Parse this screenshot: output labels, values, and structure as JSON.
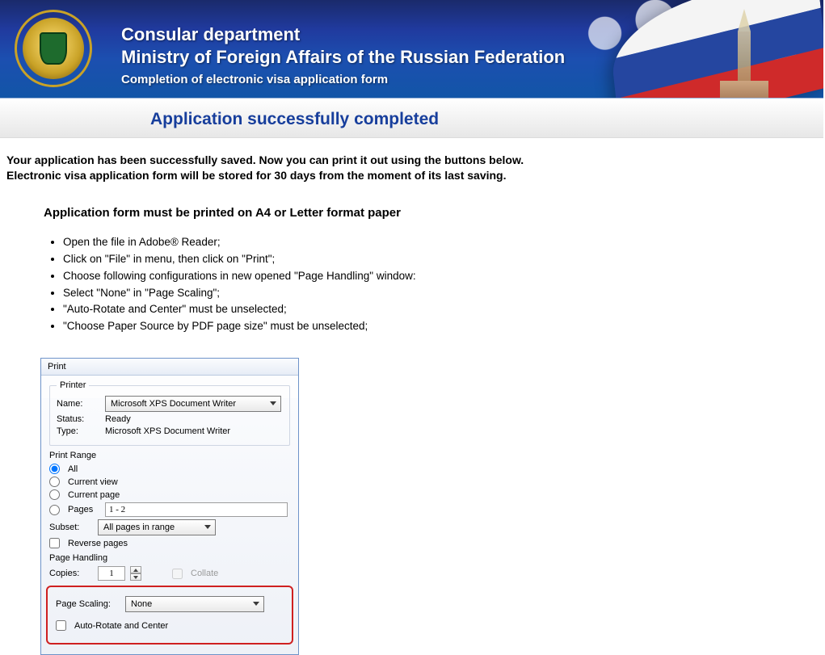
{
  "header": {
    "line1": "Consular department",
    "line2": "Ministry of Foreign Affairs of the Russian Federation",
    "line3": "Completion of electronic visa application form"
  },
  "page_title": "Application successfully completed",
  "intro": {
    "p1": "Your application has been successfully saved. Now you can print it out using the buttons below.",
    "p2": "Electronic visa application form will be stored for 30 days from the moment of its last saving."
  },
  "section_heading": "Application form must be printed on A4 or Letter format paper",
  "steps": [
    "Open the file in Adobe® Reader;",
    "Click on \"File\" in menu, then click on \"Print\";",
    "Choose following configurations in new opened \"Page Handling\" window:",
    "Select \"None\" in \"Page Scaling\";",
    "\"Auto-Rotate and Center\" must be unselected;",
    "\"Choose Paper Source by PDF page size\" must be unselected;"
  ],
  "print_dialog": {
    "title": "Print",
    "printer_group": "Printer",
    "name_label": "Name:",
    "name_value": "Microsoft XPS Document Writer",
    "status_label": "Status:",
    "status_value": "Ready",
    "type_label": "Type:",
    "type_value": "Microsoft XPS Document Writer",
    "range_group": "Print Range",
    "opt_all": "All",
    "opt_current_view": "Current view",
    "opt_current_page": "Current page",
    "opt_pages": "Pages",
    "pages_value": "1 - 2",
    "subset_label": "Subset:",
    "subset_value": "All pages in range",
    "reverse_label": "Reverse pages",
    "handling_group": "Page Handling",
    "copies_label": "Copies:",
    "copies_value": "1",
    "collate_label": "Collate",
    "scaling_label": "Page Scaling:",
    "scaling_value": "None",
    "autorotate_label": "Auto-Rotate and Center"
  }
}
